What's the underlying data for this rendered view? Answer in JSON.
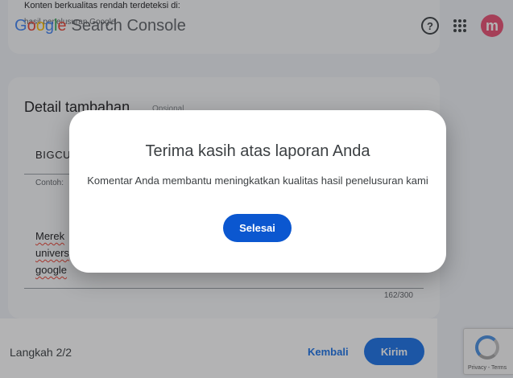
{
  "app": {
    "brand": "Google",
    "product": "Search Console"
  },
  "header": {
    "help_icon": "help-circle-icon",
    "apps_icon": "apps-grid-icon",
    "avatar_letter": "m"
  },
  "top_card": {
    "title": "Konten berkualitas rendah terdeteksi di:",
    "subtitle": "hasil penelusuran Google"
  },
  "detail": {
    "title": "Detail tambahan",
    "optional": "Opsional",
    "field1_value": "BIGCU",
    "field1_help": "Contoh:",
    "field2_lines": [
      "Merek",
      "univers",
      "google"
    ],
    "counter": "162/300"
  },
  "footer": {
    "step": "Langkah 2/2",
    "back": "Kembali",
    "submit": "Kirim"
  },
  "recaptcha": {
    "links": "Privacy - Terms"
  },
  "dialog": {
    "title": "Terima kasih atas laporan Anda",
    "body": "Komentar Anda membantu meningkatkan kualitas hasil penelusuran kami",
    "button": "Selesai"
  }
}
